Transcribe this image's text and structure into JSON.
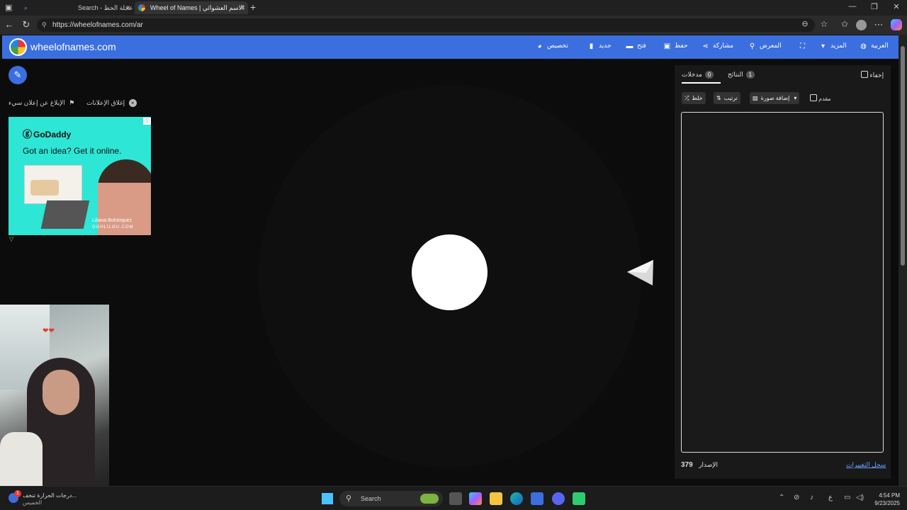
{
  "browser": {
    "tabs": [
      {
        "label": "Search - عجلة الحظ"
      },
      {
        "label": "Wheel of Names | الاسم العشوائي"
      }
    ],
    "url": "https://wheelofnames.com/ar"
  },
  "header": {
    "site_name": "wheelofnames.com",
    "menu": {
      "customize": "تخصيص",
      "new": "جديد",
      "open": "فتح",
      "save": "حفظ",
      "share": "مشاركة",
      "gallery": "المعرض",
      "more": "المزيد",
      "language": "العربية"
    }
  },
  "ads": {
    "close_ads": "إغلاق الإعلانات",
    "report_ad": "الإبلاغ عن إعلان سيء",
    "brand": "GoDaddy",
    "tagline": "Got an idea? Get it online.",
    "person_name": "Liliana Bohórquez",
    "site": "OOHLILOU.COM"
  },
  "panel": {
    "hide_label": "إخفاء",
    "tab_results": "النتائج",
    "tab_results_count": "1",
    "tab_entries": "مدخلات",
    "tab_entries_count": "0",
    "advanced_label": "مقدم",
    "add_image": "إضافة صورة",
    "sort": "ترتيب",
    "shuffle": "خلط",
    "version_label": "الإصدار",
    "version_number": "379",
    "changelog": "سجل التغييرات"
  },
  "taskbar": {
    "weather_line1": "درجات الحرارة تنخف...",
    "weather_line2": "الخميس",
    "weather_badge": "1",
    "search": "Search",
    "lang": "ع",
    "time": "4:54 PM",
    "date": "9/23/2025"
  },
  "colors": {
    "accent": "#3b6fe0",
    "background": "#0c0c0c",
    "ad_bg": "#2ee6d6"
  }
}
